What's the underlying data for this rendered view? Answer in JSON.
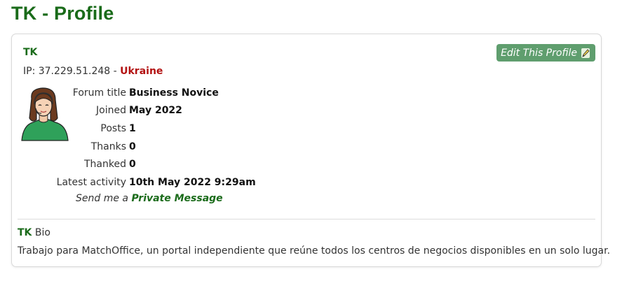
{
  "page": {
    "title": "TK - Profile"
  },
  "profile": {
    "username": "TK",
    "edit_label": "Edit This Profile",
    "ip_prefix": "IP: 37.229.51.248 - ",
    "country": "Ukraine",
    "avatar_icon": "woman-avatar-icon",
    "fields": [
      {
        "label": "Forum title",
        "value": "Business Novice"
      },
      {
        "label": "Joined",
        "value": "May 2022"
      },
      {
        "label": "Posts",
        "value": "1"
      },
      {
        "label": "Thanks",
        "value": "0"
      },
      {
        "label": "Thanked",
        "value": "0"
      },
      {
        "label": "Latest activity",
        "value": "10th May 2022 9:29am"
      }
    ],
    "pm_prefix": "Send me a",
    "pm_link": "Private Message"
  },
  "bio": {
    "username": "TK",
    "label": "Bio",
    "text": "Trabajo para MatchOffice, un portal independiente que reúne todos los centros de negocios disponibles en un solo lugar."
  },
  "colors": {
    "brand_green": "#1a6b1a",
    "button_green": "#5f9e6e",
    "country_red": "#b31212"
  }
}
